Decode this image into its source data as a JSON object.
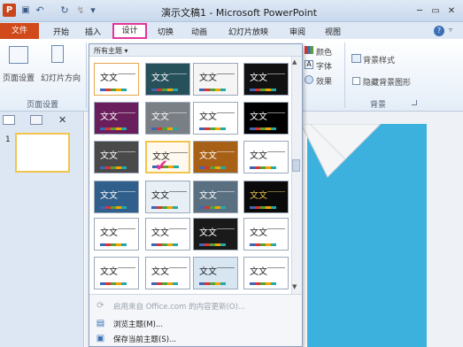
{
  "titlebar": {
    "app_icon": "P",
    "undo": "↶",
    "redo": "↻",
    "repeat": "↯",
    "qat_more": "▾",
    "title": "演示文稿1 - Microsoft PowerPoint",
    "min": "─",
    "max": "▭",
    "close": "✕"
  },
  "tabs": {
    "file": "文件",
    "home": "开始",
    "insert": "插入",
    "design": "设计",
    "transitions": "切换",
    "animations": "动画",
    "slideshow": "幻灯片放映",
    "review": "审阅",
    "view": "视图",
    "help": "?"
  },
  "ribbon": {
    "page_setup": "页面设置",
    "orientation": "幻灯片方向",
    "group_page_setup": "页面设置",
    "colors": "颜色",
    "fonts": "字体",
    "effects": "效果",
    "bg_styles": "背景样式",
    "hide_bg": "隐藏背景图形",
    "group_background": "背景"
  },
  "gallery": {
    "header": "所有主题 ▾",
    "thumb_text": "文文",
    "menu": [
      {
        "label": "启用来自 Office.com 的内容更新(O)...",
        "disabled": true
      },
      {
        "label": "浏览主题(M)...",
        "disabled": false
      },
      {
        "label": "保存当前主题(S)...",
        "disabled": false
      }
    ]
  },
  "slides": {
    "number": "1"
  },
  "colors": {
    "accent_file": "#d04a1c",
    "highlight": "#e2359a",
    "slide_blue": "#3cb1de"
  }
}
